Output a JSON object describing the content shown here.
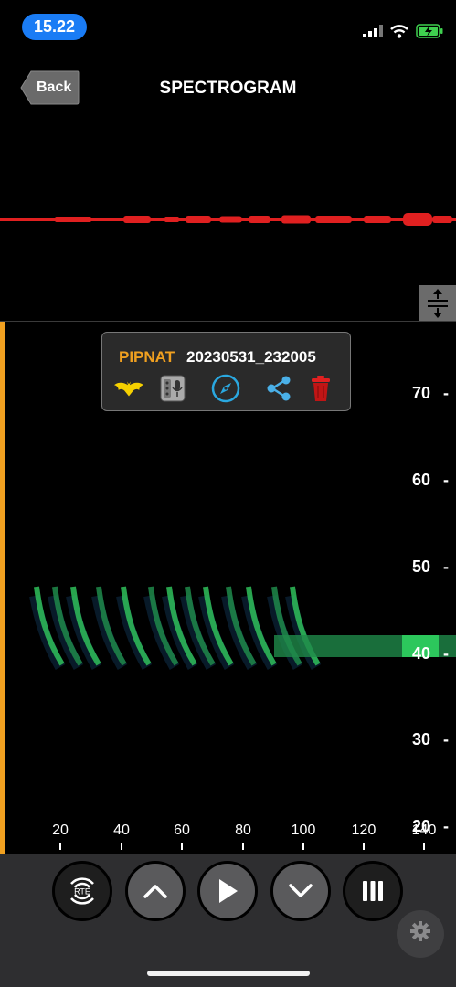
{
  "status_bar": {
    "time": "15.22"
  },
  "nav": {
    "back_label": "Back",
    "title": "SPECTROGRAM"
  },
  "popup": {
    "species": "PIPNAT",
    "filename": "20230531_232005"
  },
  "spectrogram": {
    "y_ticks": [
      "70",
      "60",
      "50",
      "40",
      "30",
      "20"
    ],
    "x_ticks": [
      "20",
      "40",
      "60",
      "80",
      "100",
      "120",
      "140"
    ]
  },
  "controls": {
    "rte_label": "RTE"
  },
  "colors": {
    "accent_orange": "#f0a020",
    "waveform_red": "#e02020",
    "status_blue": "#1a7cf5",
    "spectro_green": "#2fbf5a"
  }
}
